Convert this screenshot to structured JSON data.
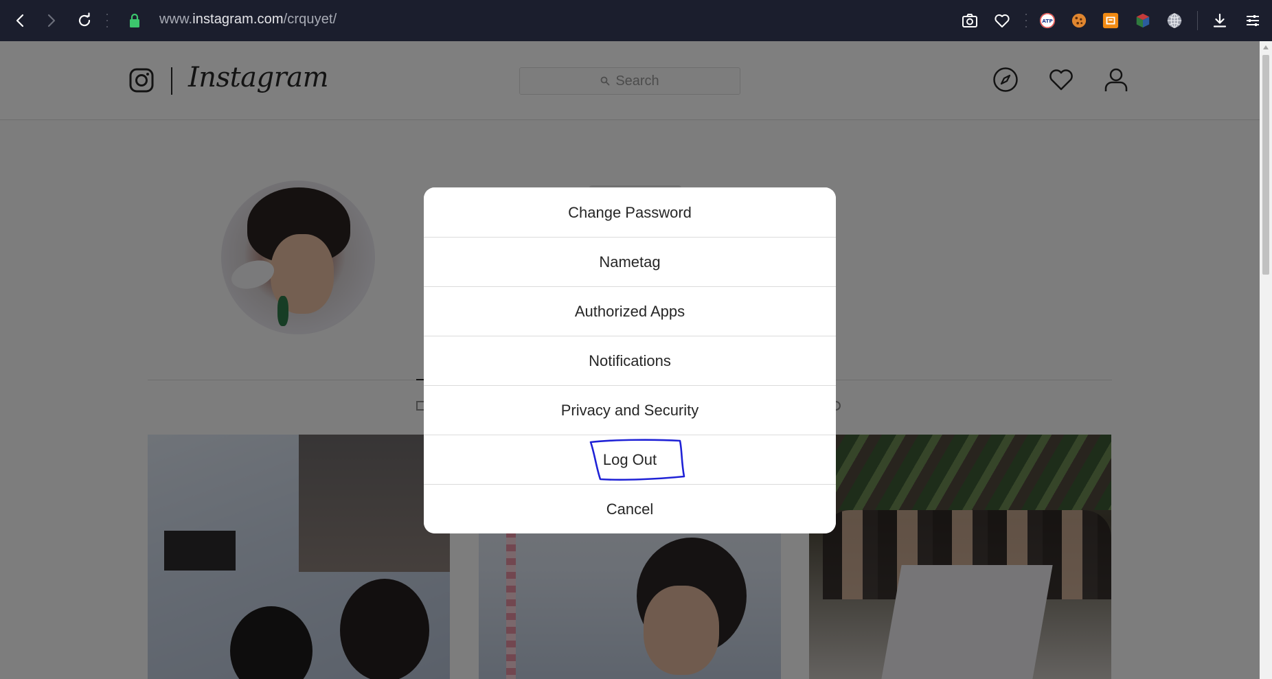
{
  "browser": {
    "url_prefix": "www.",
    "url_host": "instagram.com",
    "url_path": "/crquyet/",
    "extensions": [
      {
        "name": "atp-extension-icon",
        "label": "ATP"
      }
    ]
  },
  "instagram": {
    "wordmark": "Instagram",
    "search_placeholder": "Search"
  },
  "modal": {
    "items": [
      {
        "label": "Change Password"
      },
      {
        "label": "Nametag"
      },
      {
        "label": "Authorized Apps"
      },
      {
        "label": "Notifications"
      },
      {
        "label": "Privacy and Security"
      },
      {
        "label": "Log Out"
      },
      {
        "label": "Cancel"
      }
    ]
  },
  "colors": {
    "chrome_bg": "#1b1e2d",
    "overlay": "rgba(0,0,0,0.5)",
    "annotation_circle": "#1f22d6"
  }
}
